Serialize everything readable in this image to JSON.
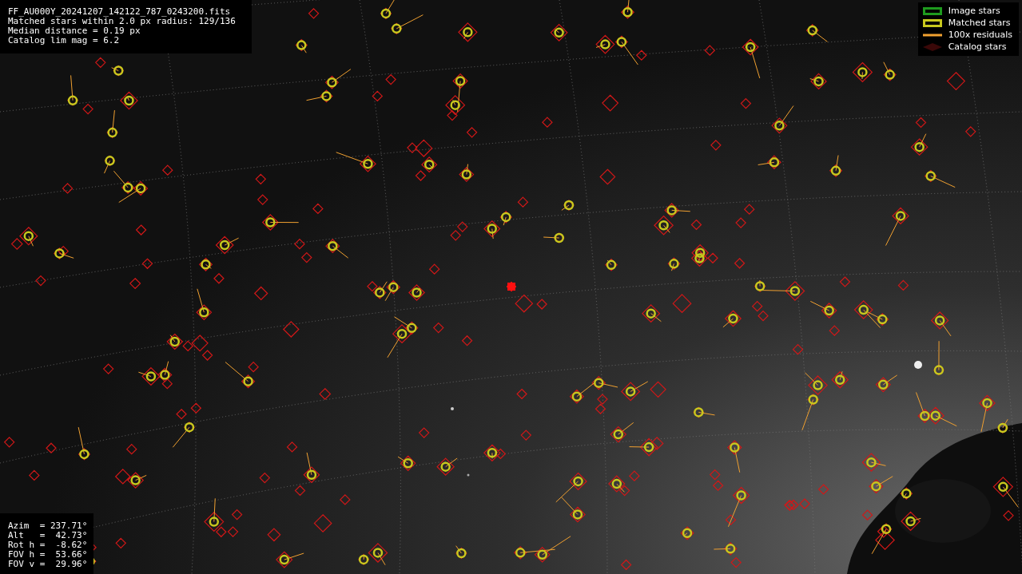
{
  "fit_info": [
    "FF_AU000Y_20241207_142122_787_0243200.fits",
    "Matched stars within 2.0 px radius: 129/136",
    "Median distance = 0.19 px",
    "Catalog lim mag = 6.2"
  ],
  "legend": [
    {
      "kind": "box",
      "label": "Image stars",
      "color": "#1e9a1e"
    },
    {
      "kind": "box",
      "label": "Matched stars",
      "color": "#c8c81e"
    },
    {
      "kind": "line",
      "label": "100x residuals",
      "color": "#f0a030"
    },
    {
      "kind": "diamond",
      "label": "Catalog stars",
      "color": "#3a0808"
    }
  ],
  "pointing": [
    "Azim  = 237.71°",
    "Alt   =  42.73°",
    "Rot h =  -8.62°",
    "FOV h =  53.66°",
    "FOV v =  29.96°"
  ]
}
